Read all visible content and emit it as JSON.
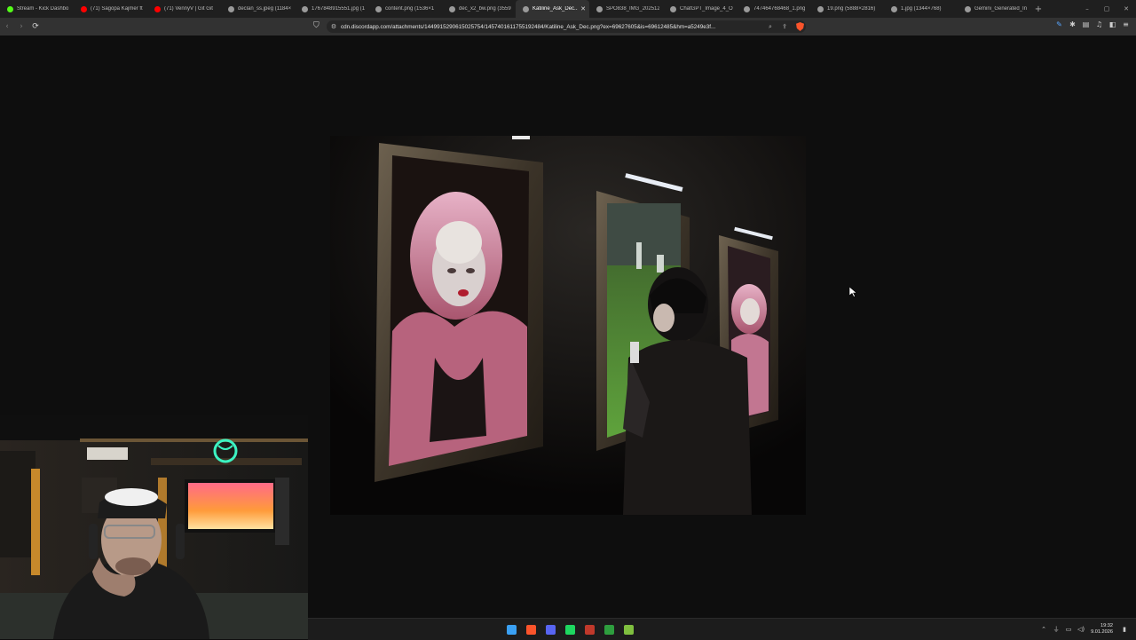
{
  "browser": {
    "tabs": [
      {
        "title": "Stream - Kick Dashbo",
        "icon": "kick-icon",
        "color": "#53fc18",
        "active": false
      },
      {
        "title": "(71) Sagopa Kajmer ft",
        "icon": "youtube-icon",
        "color": "#ff0000",
        "active": false
      },
      {
        "title": "(71) VennyV | Git Git",
        "icon": "youtube-icon",
        "color": "#ff0000",
        "active": false
      },
      {
        "title": "declan_ss.jpeg (1184×",
        "icon": "globe-icon",
        "color": "#9a9a9a",
        "active": false
      },
      {
        "title": "1767848915551.jpg (1",
        "icon": "globe-icon",
        "color": "#9a9a9a",
        "active": false
      },
      {
        "title": "content.png (1536×1",
        "icon": "globe-icon",
        "color": "#9a9a9a",
        "active": false
      },
      {
        "title": "dec_x2_bw.png (3559",
        "icon": "globe-icon",
        "color": "#9a9a9a",
        "active": false
      },
      {
        "title": "Katiline_Ask_Dec...",
        "icon": "globe-icon",
        "color": "#9a9a9a",
        "active": true
      },
      {
        "title": "SPO838_IMG_202512",
        "icon": "globe-icon",
        "color": "#9a9a9a",
        "active": false
      },
      {
        "title": "ChatGPT_Image_4_O",
        "icon": "globe-icon",
        "color": "#9a9a9a",
        "active": false
      },
      {
        "title": "747464768468_1.png",
        "icon": "globe-icon",
        "color": "#9a9a9a",
        "active": false
      },
      {
        "title": "19.png (5888×2816)",
        "icon": "globe-icon",
        "color": "#9a9a9a",
        "active": false
      },
      {
        "title": "1.jpg (1344×768)",
        "icon": "globe-icon",
        "color": "#9a9a9a",
        "active": false
      },
      {
        "title": "Gemini_Generated_In",
        "icon": "globe-icon",
        "color": "#9a9a9a",
        "active": false
      }
    ],
    "new_tab_glyph": "+",
    "url": "cdn.discordapp.com/attachments/1449915290615025754/1457401611755192484/Katiline_Ask_Dec.png?ex=69627605&is=69612485&hm=a5249e3f...",
    "accent": "#fb542b"
  },
  "taskbar": {
    "apps": [
      {
        "name": "windows-start-icon",
        "color": "#3aa0f3"
      },
      {
        "name": "brave-icon",
        "color": "#fb542b"
      },
      {
        "name": "discord-icon",
        "color": "#5865f2"
      },
      {
        "name": "spotify-icon",
        "color": "#1ed760"
      },
      {
        "name": "recording-app-icon",
        "color": "#c0392b"
      },
      {
        "name": "xbox-icon",
        "color": "#2e9e3e"
      },
      {
        "name": "media-app-icon",
        "color": "#7fbf3f"
      }
    ],
    "time": "19:32",
    "date": "9.01.2026"
  }
}
